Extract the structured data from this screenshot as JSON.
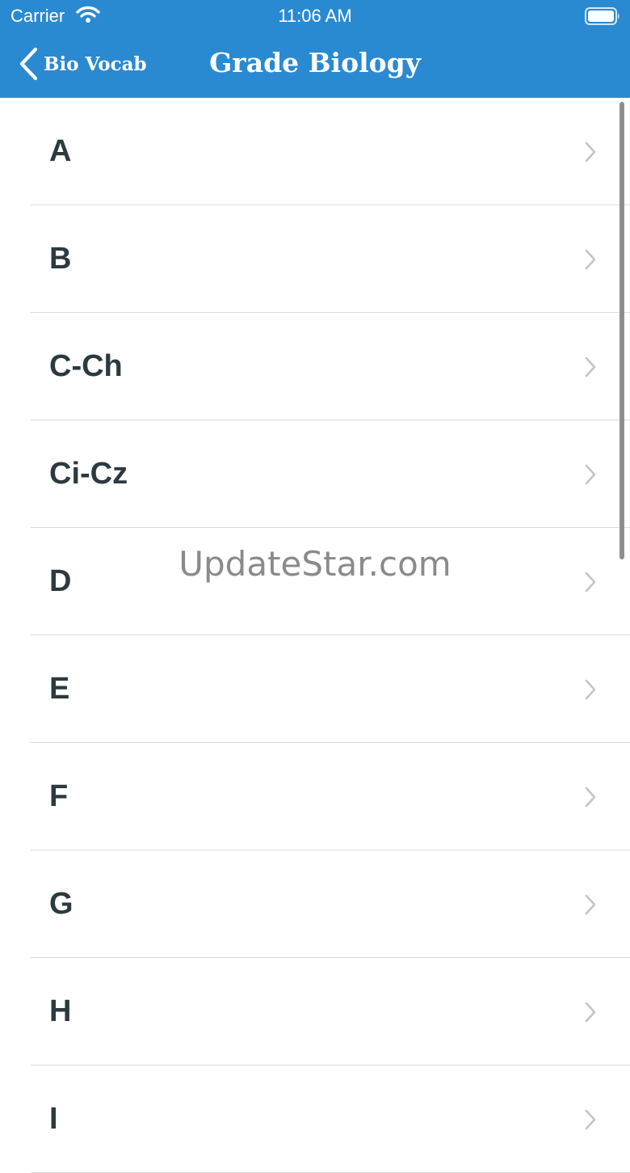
{
  "status_bar": {
    "carrier": "Carrier",
    "time": "11:06 AM"
  },
  "nav": {
    "back_label": "Bio Vocab",
    "title": "Grade Biology"
  },
  "icons": {
    "back": "chevron-left-icon",
    "row": "chevron-right-icon",
    "wifi": "wifi-icon",
    "battery": "battery-icon"
  },
  "colors": {
    "nav_bar": "#2a8ad1",
    "row_text": "#2c3a3f",
    "chevron": "#c4c4c9",
    "separator": "#dcdcdc"
  },
  "list": {
    "items": [
      {
        "label": "A"
      },
      {
        "label": "B"
      },
      {
        "label": "C-Ch"
      },
      {
        "label": "Ci-Cz"
      },
      {
        "label": "D"
      },
      {
        "label": "E"
      },
      {
        "label": "F"
      },
      {
        "label": "G"
      },
      {
        "label": "H"
      },
      {
        "label": "I"
      }
    ]
  },
  "watermark": "UpdateStar.com"
}
